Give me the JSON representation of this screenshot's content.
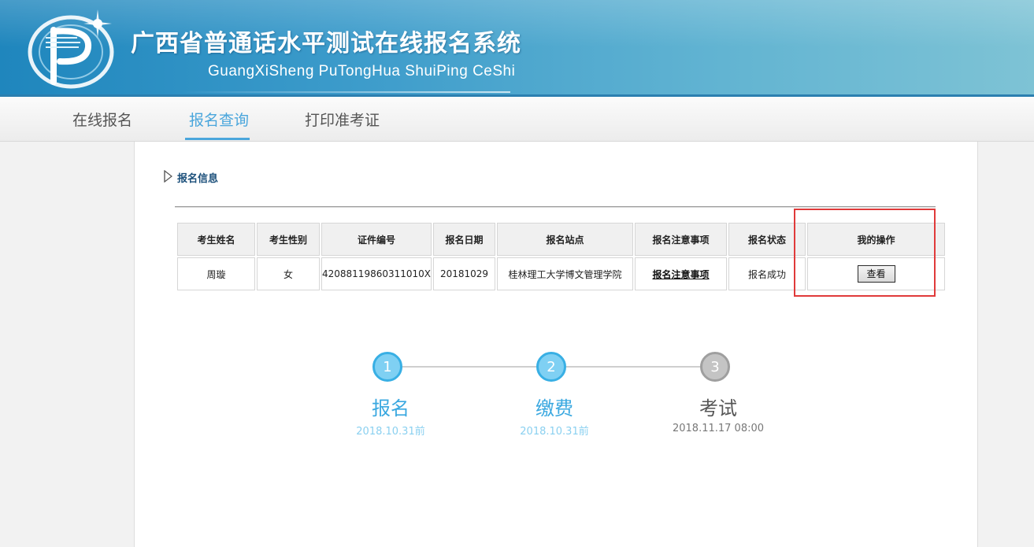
{
  "header": {
    "title_cn": "广西省普通话水平测试在线报名系统",
    "title_en": "GuangXiSheng PuTongHua ShuiPing CeShi"
  },
  "nav": {
    "items": [
      "在线报名",
      "报名查询",
      "打印准考证"
    ],
    "active": "报名查询"
  },
  "section": {
    "title": "报名信息"
  },
  "table": {
    "headers": [
      "考生姓名",
      "考生性别",
      "证件编号",
      "报名日期",
      "报名站点",
      "报名注意事项",
      "报名状态",
      "我的操作"
    ],
    "rows": [
      {
        "name": "周璇",
        "gender": "女",
        "id_number": "420881198603110 10X",
        "date": "20181029",
        "site": "桂林理工大学博文管理学院",
        "notice": "报名注意事项",
        "status": "报名成功",
        "action": "查看"
      }
    ]
  },
  "steps": [
    {
      "num": "1",
      "label": "报名",
      "date": "2018.10.31前",
      "state": "done"
    },
    {
      "num": "2",
      "label": "缴费",
      "date": "2018.10.31前",
      "state": "done"
    },
    {
      "num": "3",
      "label": "考试",
      "date": "2018.11.17 08:00",
      "state": "todo"
    }
  ],
  "colors": {
    "accent": "#4aa6dc",
    "highlight_box": "#e03a3a",
    "step_done": "#38afe4",
    "step_todo": "#9f9f9f"
  }
}
